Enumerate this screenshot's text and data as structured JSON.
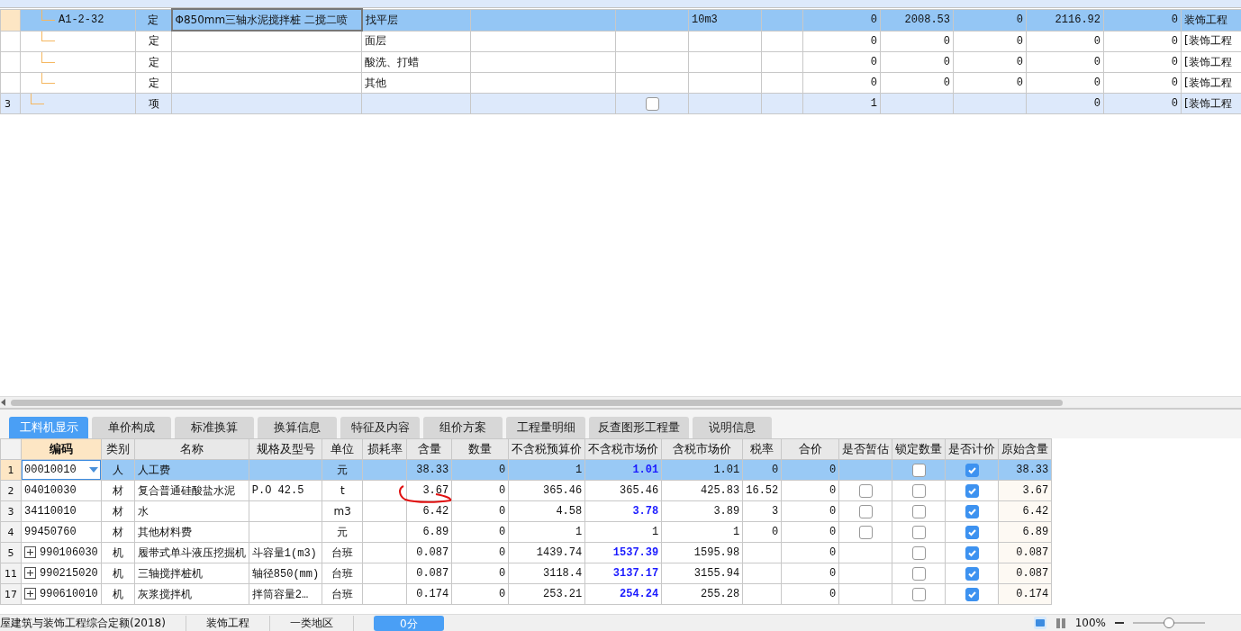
{
  "upper_grid": {
    "rows": [
      {
        "kind": "quota",
        "selected": true,
        "row_number": "",
        "code": "A1-2-32",
        "category": "定",
        "name": "Φ850mm三轴水泥搅拌桩 二搅二喷",
        "column_5": "找平层",
        "column_6": "",
        "unit": "10m3",
        "column_9": "",
        "column_10": "0",
        "column_11": "2008.53",
        "column_12": "0",
        "column_13": "2116.92",
        "column_14": "0",
        "column_15": "装饰工程"
      },
      {
        "kind": "quota",
        "selected": false,
        "row_number": "",
        "code": "",
        "category": "定",
        "name": "",
        "column_5": "面层",
        "column_6": "",
        "unit": "",
        "column_9": "",
        "column_10": "0",
        "column_11": "0",
        "column_12": "0",
        "column_13": "0",
        "column_14": "0",
        "column_15": "[装饰工程"
      },
      {
        "kind": "quota",
        "selected": false,
        "row_number": "",
        "code": "",
        "category": "定",
        "name": "",
        "column_5": "酸洗、打蜡",
        "column_6": "",
        "unit": "",
        "column_9": "",
        "column_10": "0",
        "column_11": "0",
        "column_12": "0",
        "column_13": "0",
        "column_14": "0",
        "column_15": "[装饰工程"
      },
      {
        "kind": "quota",
        "selected": false,
        "row_number": "",
        "code": "",
        "category": "定",
        "name": "",
        "column_5": "其他",
        "column_6": "",
        "unit": "",
        "column_9": "",
        "column_10": "0",
        "column_11": "0",
        "column_12": "0",
        "column_13": "0",
        "column_14": "0",
        "column_15": "[装饰工程"
      },
      {
        "kind": "item",
        "selected": false,
        "row_number": "3",
        "code": "",
        "category": "项",
        "name": "",
        "column_5": "",
        "column_6": "",
        "checked": false,
        "unit": "",
        "column_9": "",
        "column_10": "1",
        "column_11": "",
        "column_12": "",
        "column_13": "0",
        "column_14": "0",
        "column_15": "[装饰工程"
      }
    ]
  },
  "tabs": [
    {
      "label": "工料机显示",
      "selected": true
    },
    {
      "label": "单价构成",
      "selected": false
    },
    {
      "label": "标准换算",
      "selected": false
    },
    {
      "label": "换算信息",
      "selected": false
    },
    {
      "label": "特征及内容",
      "selected": false
    },
    {
      "label": "组价方案",
      "selected": false
    },
    {
      "label": "工程量明细",
      "selected": false
    },
    {
      "label": "反查图形工程量",
      "selected": false
    },
    {
      "label": "说明信息",
      "selected": false
    }
  ],
  "resource_grid": {
    "columns": [
      {
        "label": "编码",
        "selected": true
      },
      {
        "label": "类别",
        "selected": false
      },
      {
        "label": "名称",
        "selected": false
      },
      {
        "label": "规格及型号",
        "selected": false
      },
      {
        "label": "单位",
        "selected": false
      },
      {
        "label": "损耗率",
        "selected": false
      },
      {
        "label": "含量",
        "selected": false
      },
      {
        "label": "数量",
        "selected": false
      },
      {
        "label": "不含税预算价",
        "selected": false
      },
      {
        "label": "不含税市场价",
        "selected": false
      },
      {
        "label": "含税市场价",
        "selected": false
      },
      {
        "label": "税率",
        "selected": false
      },
      {
        "label": "合价",
        "selected": false
      },
      {
        "label": "是否暂估",
        "selected": false
      },
      {
        "label": "锁定数量",
        "selected": false
      },
      {
        "label": "是否计价",
        "selected": false
      },
      {
        "label": "原始含量",
        "selected": false
      }
    ],
    "rows": [
      {
        "selected": true,
        "row_number": "1",
        "expandable": false,
        "code": "00010010",
        "category": "人",
        "name": "人工费",
        "spec": "",
        "unit": "元",
        "loss_rate": "",
        "content": "38.33",
        "quantity": "0",
        "budget_price": "1",
        "market_price": "1.01",
        "market_price_adjusted": true,
        "market_price_tax": "1.01",
        "tax_rate": "0",
        "total": "0",
        "locked": false,
        "priced": true,
        "original_content": "38.33"
      },
      {
        "selected": false,
        "row_number": "2",
        "expandable": false,
        "code": "04010030",
        "category": "材",
        "name": "复合普通硅酸盐水泥",
        "spec": "P.O 42.5",
        "unit": "t",
        "loss_rate": "",
        "content": "3.67",
        "annotated": true,
        "quantity": "0",
        "budget_price": "365.46",
        "market_price": "365.46",
        "market_price_adjusted": false,
        "market_price_tax": "425.83",
        "tax_rate": "16.52",
        "total": "0",
        "provisional": false,
        "locked": false,
        "priced": true,
        "original_content": "3.67"
      },
      {
        "selected": false,
        "row_number": "3",
        "expandable": false,
        "code": "34110010",
        "category": "材",
        "name": "水",
        "spec": "",
        "unit": "m3",
        "loss_rate": "",
        "content": "6.42",
        "quantity": "0",
        "budget_price": "4.58",
        "market_price": "3.78",
        "market_price_adjusted": true,
        "market_price_tax": "3.89",
        "tax_rate": "3",
        "total": "0",
        "provisional": false,
        "locked": false,
        "priced": true,
        "original_content": "6.42"
      },
      {
        "selected": false,
        "row_number": "4",
        "expandable": false,
        "code": "99450760",
        "category": "材",
        "name": "其他材料费",
        "spec": "",
        "unit": "元",
        "loss_rate": "",
        "content": "6.89",
        "quantity": "0",
        "budget_price": "1",
        "market_price": "1",
        "market_price_adjusted": false,
        "market_price_tax": "1",
        "tax_rate": "0",
        "total": "0",
        "provisional": false,
        "locked": false,
        "priced": true,
        "original_content": "6.89"
      },
      {
        "selected": false,
        "row_number": "5",
        "expandable": true,
        "code": "990106030",
        "category": "机",
        "name": "履带式单斗液压挖掘机",
        "spec": "斗容量1(m3)",
        "unit": "台班",
        "loss_rate": "",
        "content": "0.087",
        "quantity": "0",
        "budget_price": "1439.74",
        "market_price": "1537.39",
        "market_price_adjusted": true,
        "market_price_tax": "1595.98",
        "tax_rate": "",
        "total": "0",
        "locked": false,
        "priced": true,
        "original_content": "0.087"
      },
      {
        "selected": false,
        "row_number": "11",
        "expandable": true,
        "code": "990215020",
        "category": "机",
        "name": "三轴搅拌桩机",
        "spec": "轴径850(mm)",
        "unit": "台班",
        "loss_rate": "",
        "content": "0.087",
        "quantity": "0",
        "budget_price": "3118.4",
        "market_price": "3137.17",
        "market_price_adjusted": true,
        "market_price_tax": "3155.94",
        "tax_rate": "",
        "total": "0",
        "locked": false,
        "priced": true,
        "original_content": "0.087"
      },
      {
        "selected": false,
        "row_number": "17",
        "expandable": true,
        "code": "990610010",
        "category": "机",
        "name": "灰浆搅拌机",
        "spec": "拌筒容量2…",
        "unit": "台班",
        "loss_rate": "",
        "content": "0.174",
        "quantity": "0",
        "budget_price": "253.21",
        "market_price": "254.24",
        "market_price_adjusted": true,
        "market_price_tax": "255.28",
        "tax_rate": "",
        "total": "0",
        "locked": false,
        "priced": true,
        "original_content": "0.174"
      }
    ]
  },
  "status_bar": {
    "items": [
      "屋建筑与装饰工程综合定额(2018)",
      "装饰工程",
      "一类地区"
    ],
    "score_button": "0分",
    "zoom": "100%",
    "zoom_slider": {
      "level": 0.5
    }
  }
}
